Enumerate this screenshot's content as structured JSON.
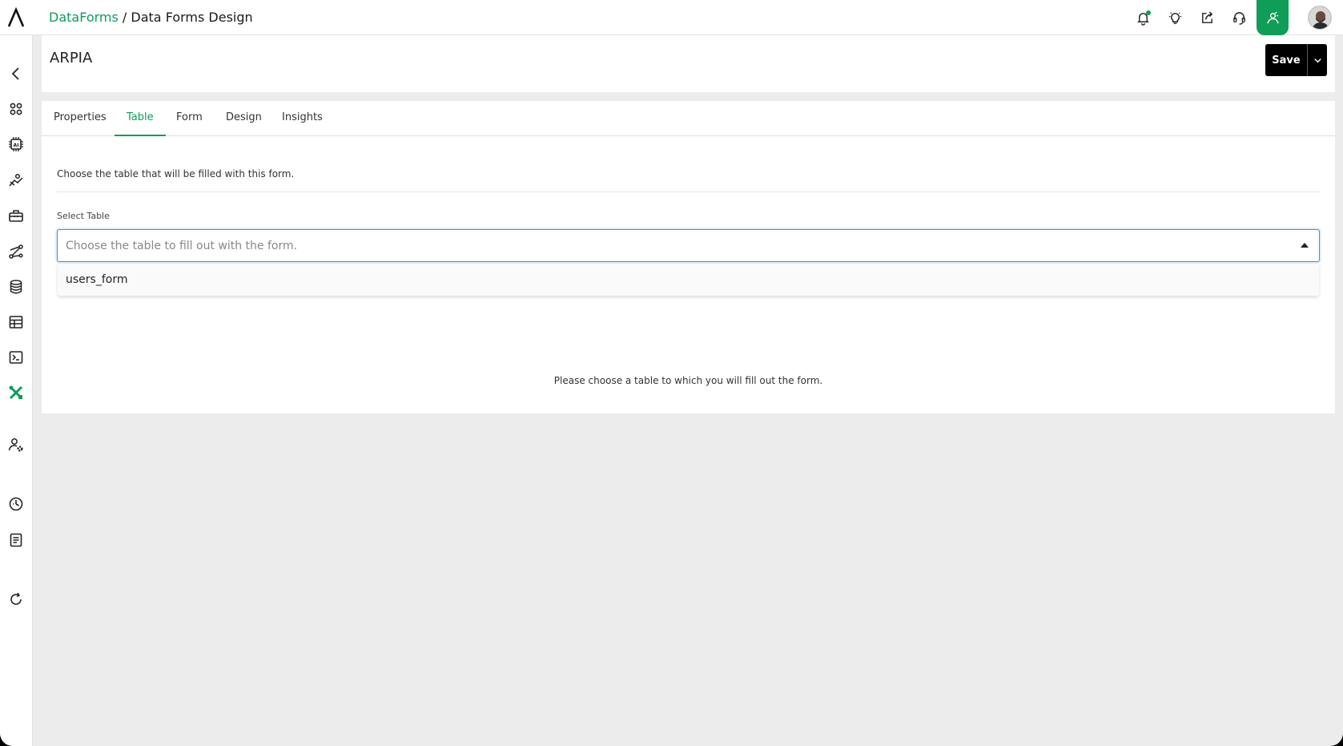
{
  "topbar": {
    "breadcrumb_link": "DataForms",
    "breadcrumb_sep": " / ",
    "breadcrumb_current": "Data Forms Design"
  },
  "header": {
    "title": "ARPIA",
    "save_label": "Save"
  },
  "tabs": [
    {
      "label": "Properties"
    },
    {
      "label": "Table"
    },
    {
      "label": "Form"
    },
    {
      "label": "Design"
    },
    {
      "label": "Insights"
    }
  ],
  "active_tab": "Table",
  "table_section": {
    "description": "Choose the table that will be filled with this form.",
    "field_label": "Select Table",
    "placeholder": "Choose the table to fill out with the form.",
    "options": [
      "users_form"
    ],
    "empty_message": "Please choose a table to which you will fill out the form."
  },
  "colors": {
    "accent": "#0f9d58",
    "focus_border": "#3f8fd6",
    "background": "#ececec"
  },
  "icons": {
    "sidebar": [
      "back-arrow-icon",
      "apps-grid-icon",
      "ai-chip-icon",
      "workflow-icon",
      "toolbox-icon",
      "graph-icon",
      "database-icon",
      "table-icon",
      "terminal-icon",
      "tools-icon",
      "user-settings-icon",
      "dashboard-gauge-icon",
      "document-icon",
      "refresh-icon"
    ],
    "topbar": [
      "bell-icon",
      "lightbulb-icon",
      "share-icon",
      "headset-icon",
      "user-active-icon"
    ]
  }
}
